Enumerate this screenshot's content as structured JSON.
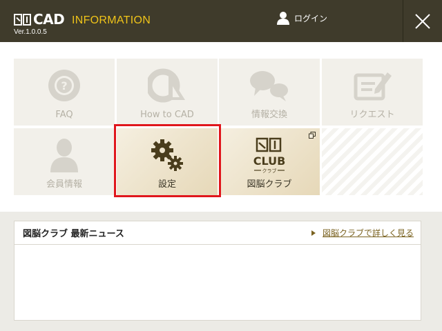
{
  "app": {
    "logo_text": "CAD",
    "title": "INFORMATION",
    "version": "Ver.1.0.0.5"
  },
  "header": {
    "login_label": "ログイン"
  },
  "tiles": [
    {
      "label": "FAQ",
      "icon": "faq-icon",
      "state": "disabled"
    },
    {
      "label": "How to CAD",
      "icon": "triangle-ruler-icon",
      "state": "disabled"
    },
    {
      "label": "情報交換",
      "icon": "chat-bubbles-icon",
      "state": "disabled"
    },
    {
      "label": "リクエスト",
      "icon": "request-edit-icon",
      "state": "disabled"
    },
    {
      "label": "会員情報",
      "icon": "user-icon",
      "state": "disabled"
    },
    {
      "label": "設定",
      "icon": "gears-icon",
      "state": "active"
    },
    {
      "label": "図脳クラブ",
      "icon": "club-logo-icon",
      "state": "active",
      "club_text": "CLUB",
      "club_sub": "クラブ"
    }
  ],
  "news": {
    "title": "図脳クラブ 最新ニュース",
    "link": "図脳クラブで詳しく見る"
  },
  "colors": {
    "titlebar": "#3f3b2b",
    "accent": "#f0c419",
    "highlight": "#e0161c",
    "link": "#7a6220"
  }
}
